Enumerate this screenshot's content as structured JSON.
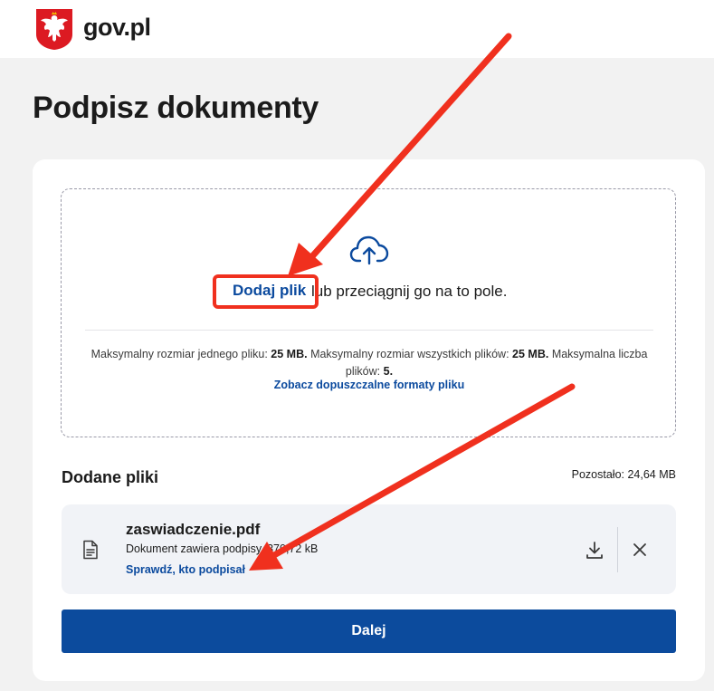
{
  "header": {
    "brand": "gov.pl",
    "emblem_icon": "polish-eagle-emblem-icon"
  },
  "page": {
    "title": "Podpisz dokumenty"
  },
  "dropzone": {
    "upload_icon": "cloud-upload-icon",
    "add_file_label": "Dodaj plik",
    "drag_text": "lub przeciągnij go na to pole.",
    "limits": {
      "max_single_label": "Maksymalny rozmiar jednego pliku:",
      "max_single_value": "25 MB.",
      "max_total_label": "Maksymalny rozmiar wszystkich plików:",
      "max_total_value": "25 MB.",
      "max_count_label": "Maksymalna liczba plików:",
      "max_count_value": "5."
    },
    "formats_link": "Zobacz dopuszczalne formaty pliku"
  },
  "files": {
    "title": "Dodane pliki",
    "remaining": "Pozostało: 24,64 MB",
    "items": [
      {
        "name": "zaswiadczenie.pdf",
        "description": "Dokument zawiera podpisy, 370,72 kB",
        "check_link": "Sprawdź, kto podpisał",
        "icon": "document-icon",
        "download_icon": "download-icon",
        "remove_icon": "close-icon"
      }
    ]
  },
  "actions": {
    "next_label": "Dalej"
  },
  "colors": {
    "link": "#0b4a9e",
    "primary_button": "#0c4b9d",
    "annotation": "#f0301e",
    "background": "#f2f2f2"
  }
}
